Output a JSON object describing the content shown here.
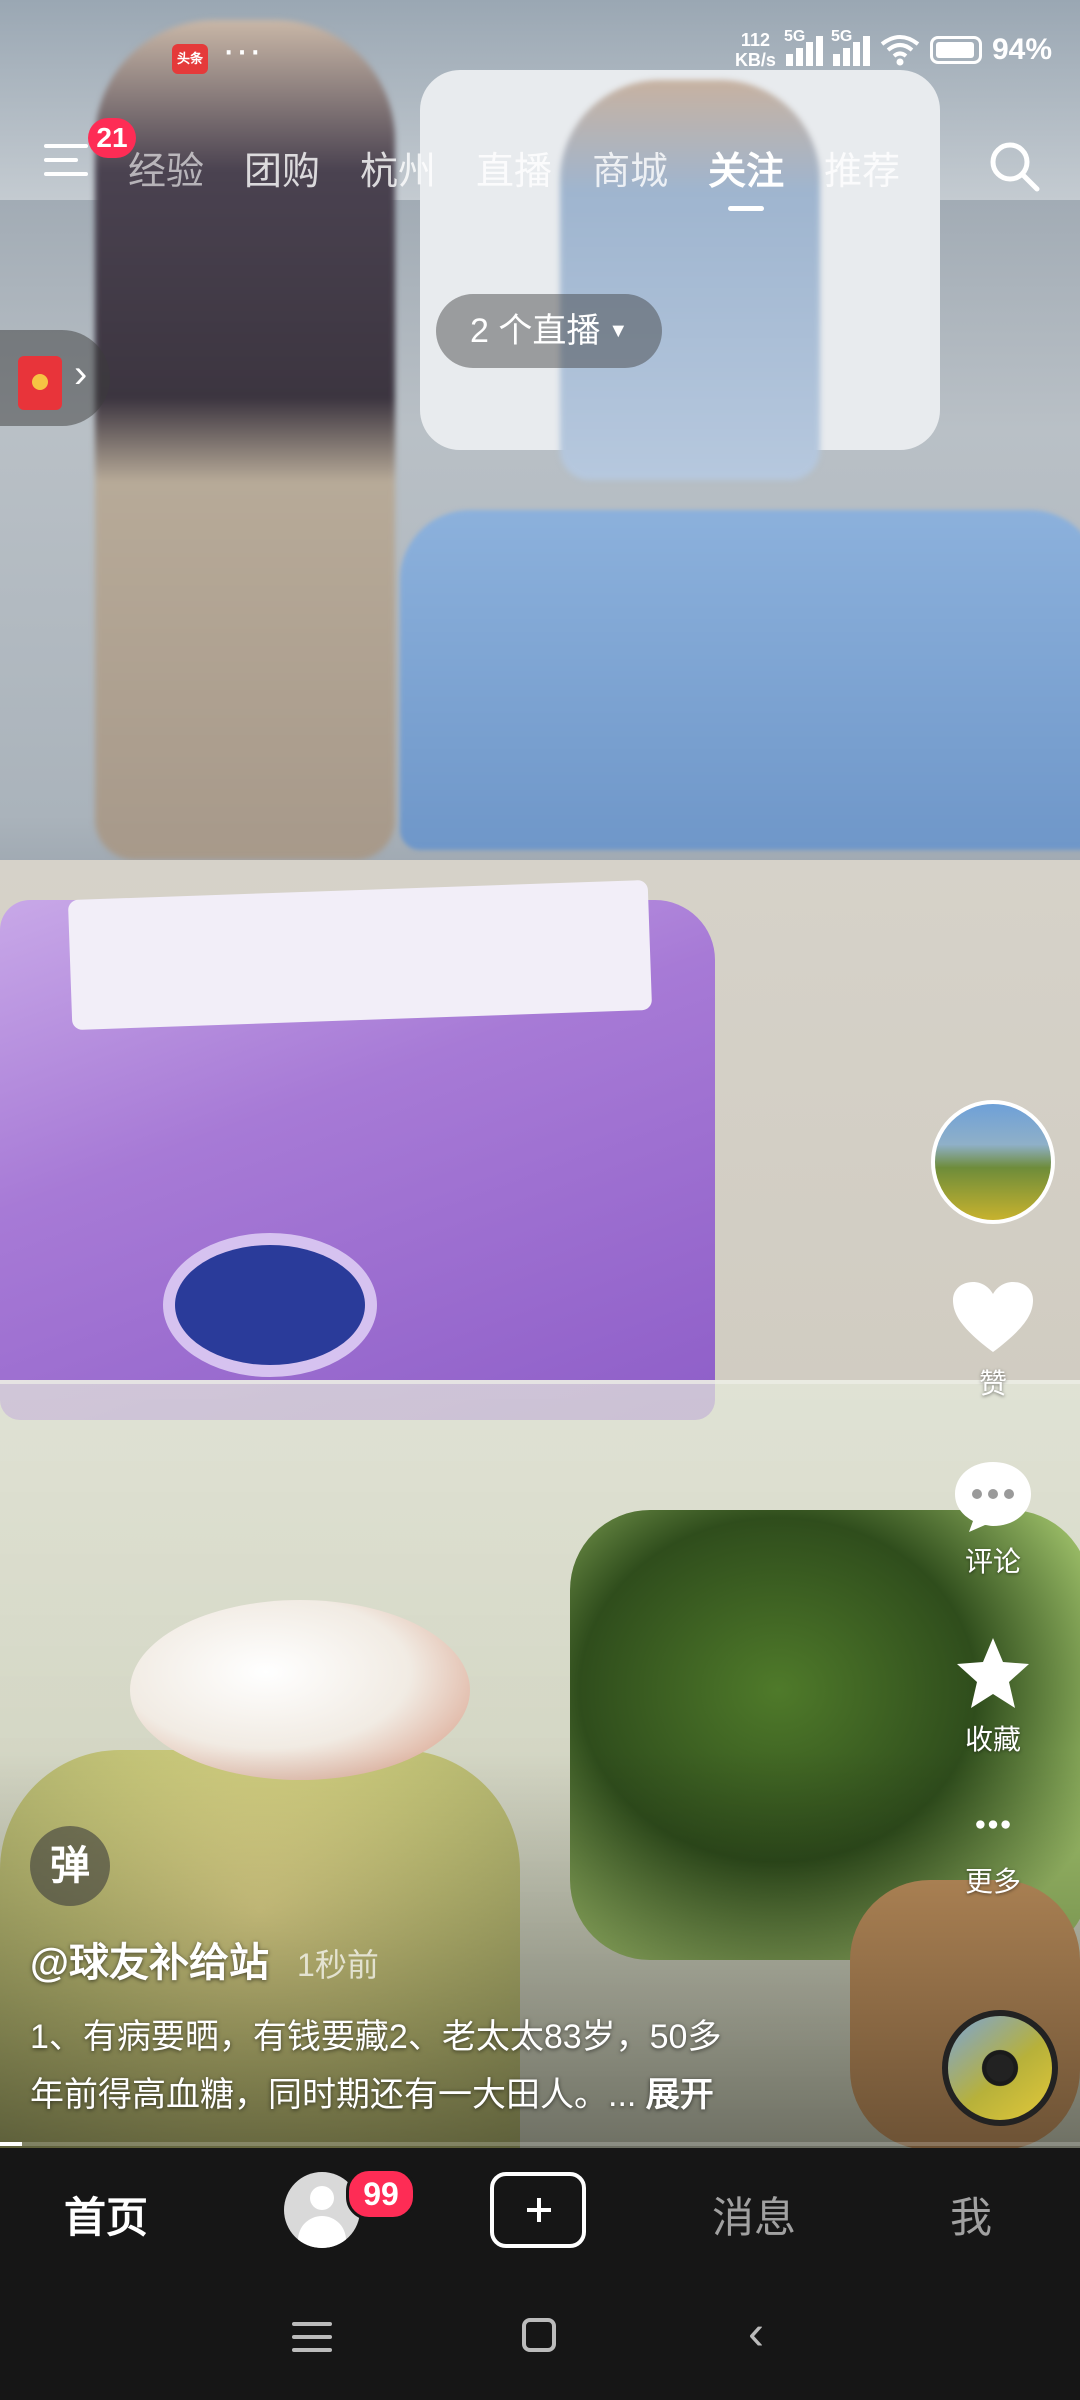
{
  "status_bar": {
    "app_badge": "头条",
    "net_speed_top": "112",
    "net_speed_bottom": "KB/s",
    "sim1": "5G",
    "sim2": "5G",
    "battery": "94%"
  },
  "top_nav": {
    "menu_badge": "21",
    "tabs": [
      {
        "label": "经验"
      },
      {
        "label": "团购"
      },
      {
        "label": "杭州"
      },
      {
        "label": "直播"
      },
      {
        "label": "商城"
      },
      {
        "label": "关注"
      },
      {
        "label": "推荐"
      }
    ],
    "active_tab": "关注"
  },
  "live_pill": "2 个直播",
  "right_rail": {
    "like_label": "赞",
    "comment_label": "评论",
    "favorite_label": "收藏",
    "more_label": "更多"
  },
  "caption": {
    "danmu_label": "弹",
    "author": "@球友补给站",
    "time": "1秒前",
    "desc_line1": "1、有病要晒，有钱要藏2、老太太83岁，50多",
    "desc_line2": "年前得高血糖，同时期还有一大田人。...",
    "expand": "展开",
    "progress": 0.02
  },
  "bottom_bar": {
    "home": "首页",
    "friend_badge": "99",
    "messages": "消息",
    "me": "我"
  },
  "colors": {
    "accent": "#fe2c55",
    "bar_bg": "#161616"
  },
  "icons": [
    "menu-icon",
    "search-icon",
    "red-packet-icon",
    "heart-icon",
    "comment-icon",
    "star-icon",
    "more-icon",
    "plus-icon",
    "user-icon"
  ]
}
